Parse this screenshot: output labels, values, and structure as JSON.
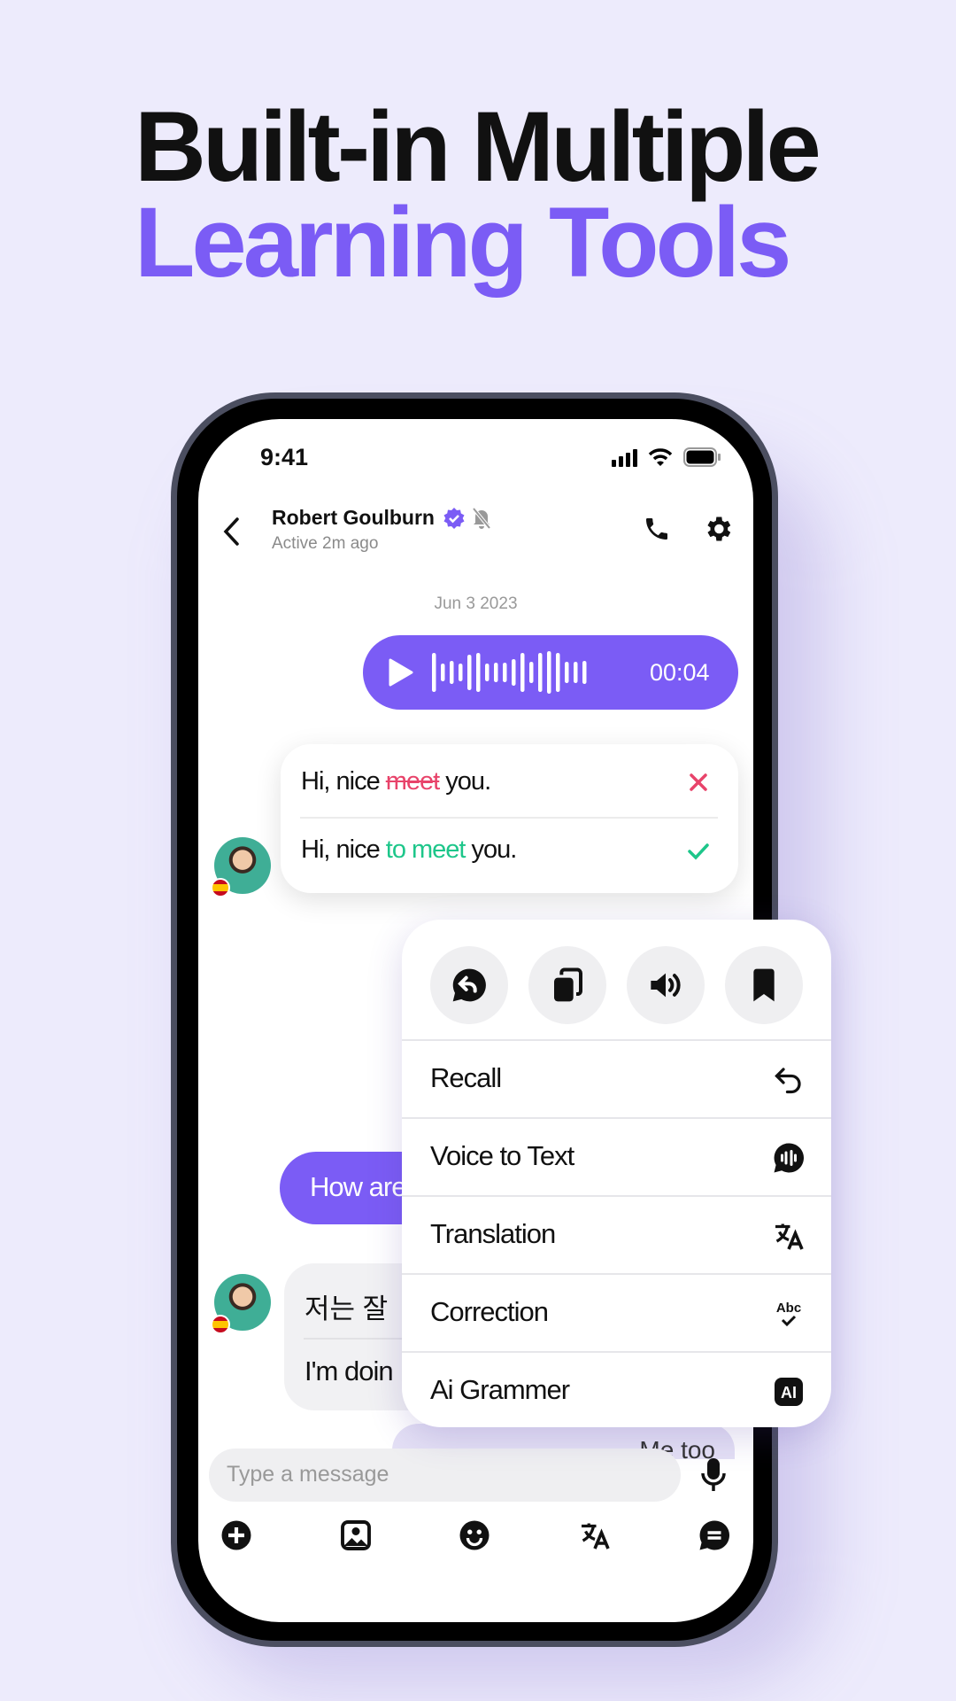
{
  "headline": {
    "line1": "Built-in Multiple",
    "line2": "Learning Tools"
  },
  "colors": {
    "accent": "#7B5CF5",
    "background": "#EDEBFC",
    "correct": "#1DC68A",
    "wrong": "#E8436A"
  },
  "status_bar": {
    "time": "9:41"
  },
  "chat_header": {
    "name": "Robert Goulburn",
    "status": "Active 2m ago",
    "icons": [
      "back-icon",
      "verified-badge-icon",
      "muted-bell-icon",
      "phone-icon",
      "gear-icon"
    ]
  },
  "messages": {
    "date": "Jun 3 2023",
    "voice": {
      "duration": "00:04"
    },
    "correction": {
      "wrong_prefix": "Hi, nice ",
      "wrong_word": "meet",
      "wrong_suffix": " you.",
      "right_prefix": "Hi, nice ",
      "right_word": "to meet",
      "right_suffix": " you."
    },
    "sent_text": "How are",
    "received_korean": "저는 잘",
    "received_english": "I'm doin",
    "sent_partial": "Me too"
  },
  "context_menu": {
    "quick_actions": [
      "reply-icon",
      "copy-icon",
      "speaker-icon",
      "bookmark-icon"
    ],
    "items": [
      {
        "label": "Recall",
        "icon": "undo-icon"
      },
      {
        "label": "Voice to Text",
        "icon": "voice-bubble-icon"
      },
      {
        "label": "Translation",
        "icon": "translate-icon"
      },
      {
        "label": "Correction",
        "icon": "abc-check-icon"
      },
      {
        "label": "Ai Grammer",
        "icon": "ai-icon"
      }
    ]
  },
  "composer": {
    "placeholder": "Type a message",
    "toolbar": [
      "plus-icon",
      "image-icon",
      "emoji-icon",
      "translate-icon",
      "chat-icon"
    ]
  }
}
